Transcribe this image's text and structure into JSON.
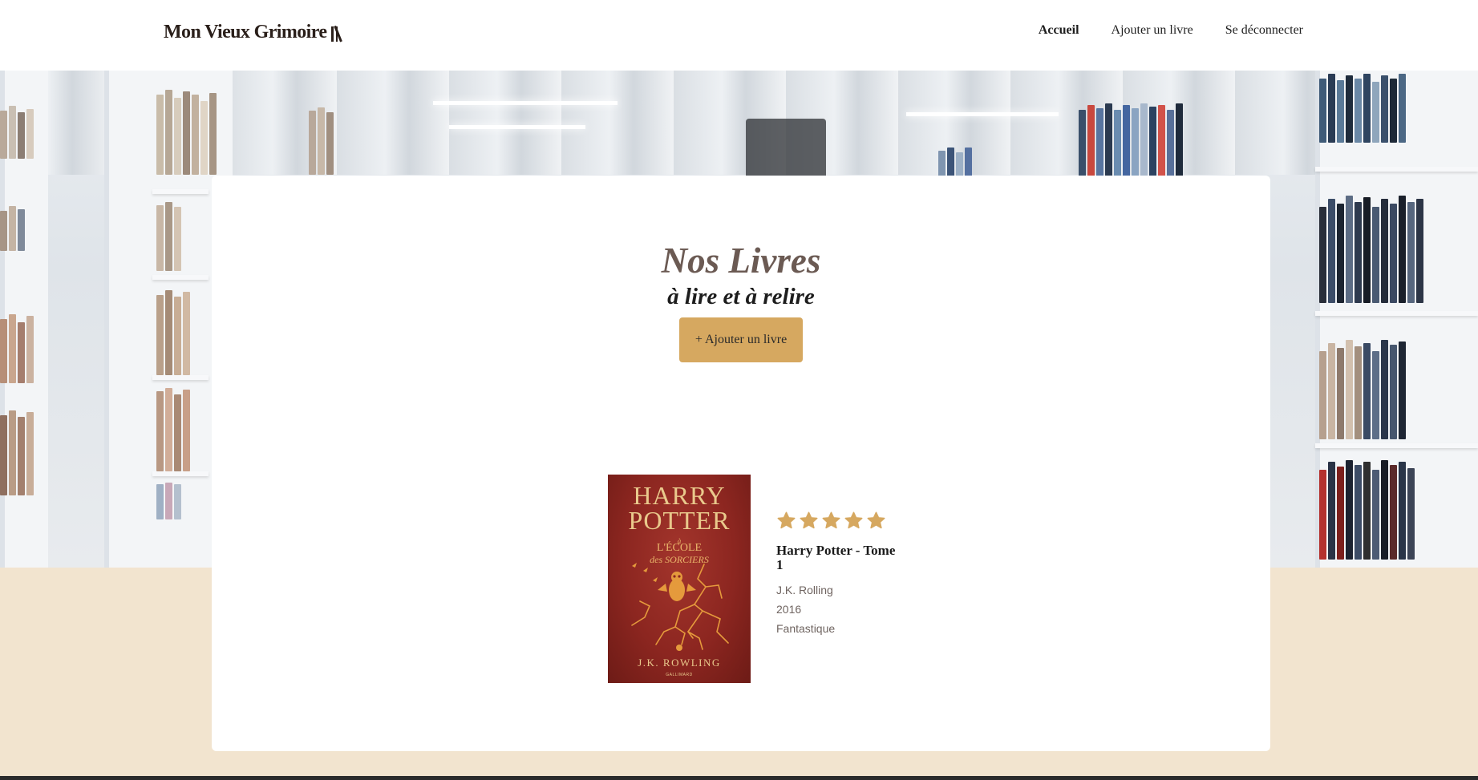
{
  "header": {
    "logo_text": "Mon Vieux Grimoire",
    "nav": [
      {
        "label": "Accueil",
        "active": true
      },
      {
        "label": "Ajouter un livre",
        "active": false
      },
      {
        "label": "Se déconnecter",
        "active": false
      }
    ]
  },
  "main": {
    "title": "Nos Livres",
    "subtitle": "à lire et à relire",
    "add_button_label": "+ Ajouter un livre"
  },
  "books": [
    {
      "title": "Harry Potter - Tome 1",
      "author": "J.K. Rolling",
      "year": "2016",
      "genre": "Fantastique",
      "rating": 5,
      "cover": {
        "line1": "HARRY",
        "line2": "POTTER",
        "sub1": "à",
        "sub2": "L'ÉCOLE",
        "sub3": "des SORCIERS",
        "author": "J.K. ROWLING",
        "publisher": "GALLIMARD"
      }
    }
  ],
  "colors": {
    "accent": "#d6a860",
    "title_color": "#6b5a53",
    "page_background": "#f2e4cf",
    "cover_red": "#8c2620"
  }
}
